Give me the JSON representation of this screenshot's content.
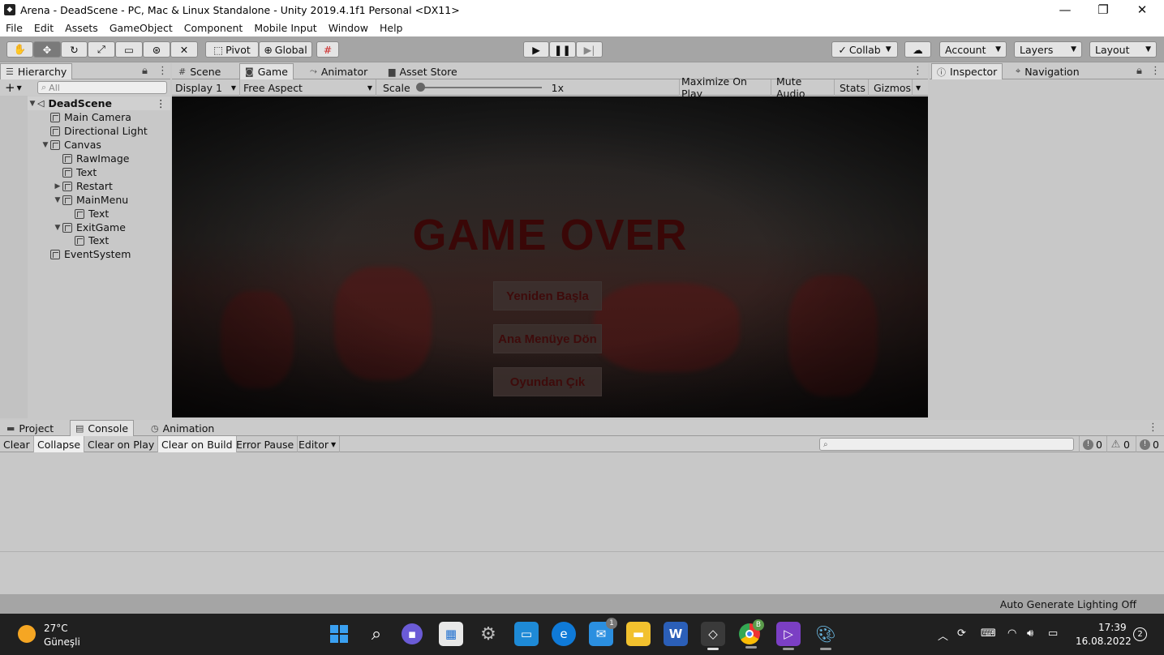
{
  "window": {
    "title": "Arena - DeadScene - PC, Mac & Linux Standalone - Unity 2019.4.1f1 Personal <DX11>",
    "minimize": "—",
    "restore": "❐",
    "close": "✕"
  },
  "menu": [
    "File",
    "Edit",
    "Assets",
    "GameObject",
    "Component",
    "Mobile Input",
    "Window",
    "Help"
  ],
  "toolbar": {
    "pivot": "Pivot",
    "global": "Global",
    "collab": "Collab",
    "account": "Account",
    "layers": "Layers",
    "layout": "Layout"
  },
  "hierarchy": {
    "tab": "Hierarchy",
    "search_placeholder": "All",
    "scene": "DeadScene",
    "items": [
      "Main Camera",
      "Directional Light",
      "Canvas",
      "RawImage",
      "Text",
      "Restart",
      "MainMenu",
      "Text",
      "ExitGame",
      "Text",
      "EventSystem"
    ]
  },
  "center_tabs": [
    "Scene",
    "Game",
    "Animator",
    "Asset Store"
  ],
  "game_toolbar": {
    "display": "Display 1",
    "aspect": "Free Aspect",
    "scale_label": "Scale",
    "scale_value": "1x",
    "maximize": "Maximize On Play",
    "mute": "Mute Audio",
    "stats": "Stats",
    "gizmos": "Gizmos"
  },
  "game": {
    "title": "GAME OVER",
    "buttons": [
      "Yeniden Başla",
      "Ana Menüye Dön",
      "Oyundan Çık"
    ]
  },
  "right_tabs": [
    "Inspector",
    "Navigation"
  ],
  "bottom_tabs": [
    "Project",
    "Console",
    "Animation"
  ],
  "console": {
    "clear": "Clear",
    "collapse": "Collapse",
    "clear_on_play": "Clear on Play",
    "clear_on_build": "Clear on Build",
    "error_pause": "Error Pause",
    "editor": "Editor",
    "log_count": "0",
    "warn_count": "0",
    "error_count": "0"
  },
  "status": "Auto Generate Lighting Off",
  "taskbar": {
    "temp": "27°C",
    "weather": "Güneşli",
    "time": "17:39",
    "date": "16.08.2022",
    "notifications": "2",
    "mail_badge": "1",
    "chrome_badge": "B"
  }
}
